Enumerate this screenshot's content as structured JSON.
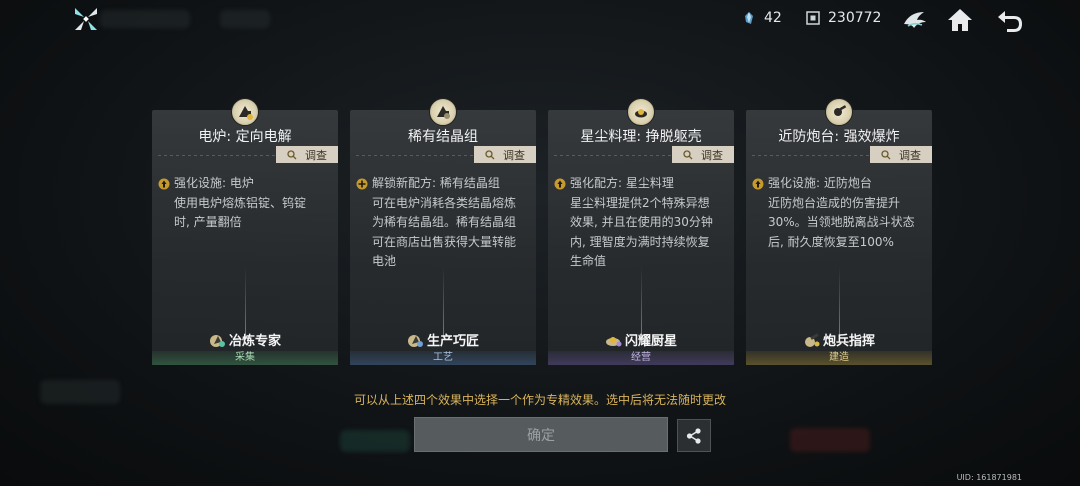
{
  "header": {
    "currency_a": {
      "icon": "crystal-icon",
      "value": "42"
    },
    "currency_b": {
      "icon": "coin-icon",
      "value": "230772"
    },
    "icons": [
      "faction-emblem-icon",
      "home-icon",
      "back-icon"
    ]
  },
  "cards": [
    {
      "title": "电炉: 定向电解",
      "investigate": "调查",
      "desc_line1": "强化设施: 电炉",
      "desc_body": [
        "使用电炉熔炼铝锭、钨锭",
        "时, 产量翻倍"
      ],
      "badge": "冶炼专家",
      "category": "采集",
      "accent": "#3d7a52"
    },
    {
      "title": "稀有结晶组",
      "investigate": "调查",
      "desc_line1": "解锁新配方: 稀有结晶组",
      "desc_body": [
        "可在电炉消耗各类结晶熔炼",
        "为稀有结晶组。稀有结晶组",
        "可在商店出售获得大量转能",
        "电池"
      ],
      "badge": "生产巧匠",
      "category": "工艺",
      "accent": "#3e5e86"
    },
    {
      "title": "星尘料理: 挣脱躯壳",
      "investigate": "调查",
      "desc_line1": "强化配方: 星尘料理",
      "desc_body": [
        "星尘料理提供2个特殊异想",
        "效果, 并且在使用的30分钟",
        "内, 理智度为满时持续恢复",
        "生命值"
      ],
      "badge": "闪耀厨星",
      "category": "经营",
      "accent": "#5b4c86"
    },
    {
      "title": "近防炮台: 强效爆炸",
      "investigate": "调查",
      "desc_line1": "强化设施: 近防炮台",
      "desc_body": [
        "近防炮台造成的伤害提升",
        "30%。当领地脱离战斗状态",
        "后, 耐久度恢复至100%"
      ],
      "badge": "炮兵指挥",
      "category": "建造",
      "accent": "#8a7530"
    }
  ],
  "notice": "可以从上述四个效果中选择一个作为专精效果。选中后将无法随时更改",
  "confirm_label": "确定",
  "uid": "UID: 161871981"
}
